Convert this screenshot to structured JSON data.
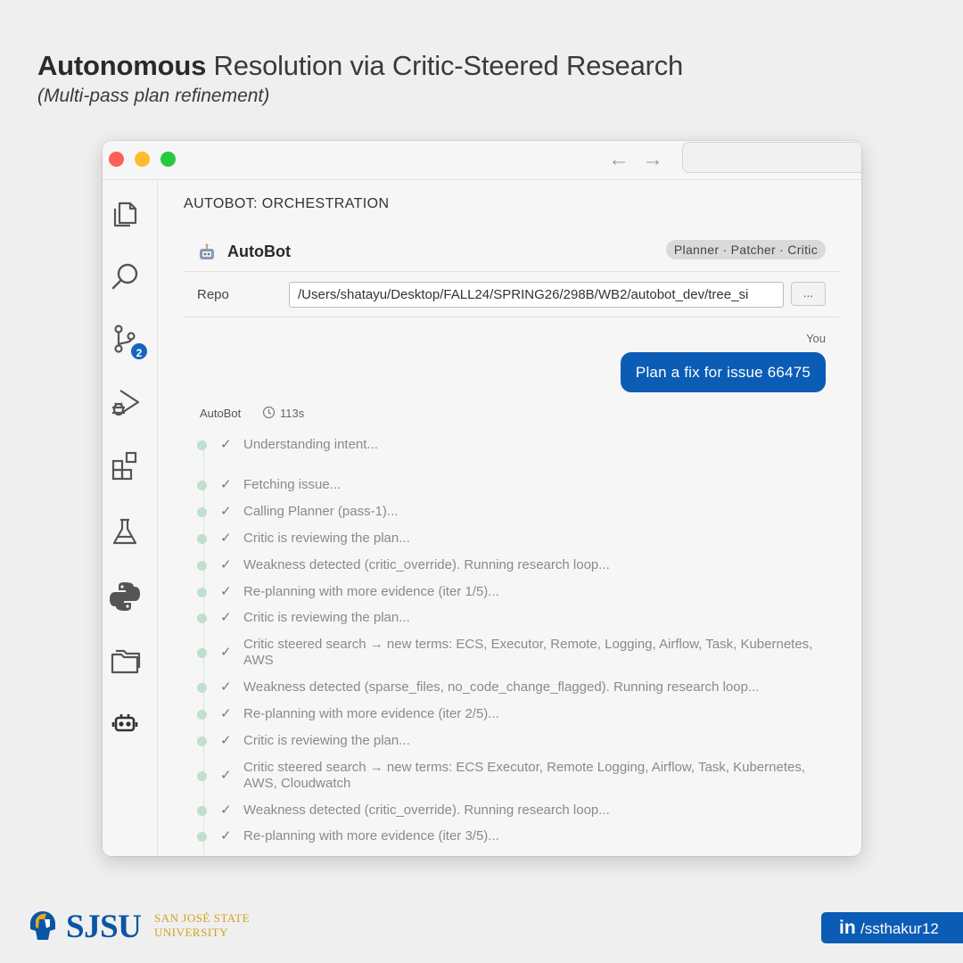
{
  "headline": {
    "bold": "Autonomous",
    "rest": " Resolution via Critic-Steered Research",
    "subtitle": "(Multi-pass plan refinement)"
  },
  "window": {
    "nav": {
      "back": "←",
      "forward": "→"
    },
    "activity_bar": {
      "source_control_badge": "2"
    },
    "panel": {
      "title": "AUTOBOT: ORCHESTRATION",
      "app_name": "AutoBot",
      "roles": "Planner · Patcher · Critic",
      "repo_label": "Repo",
      "repo_value": "/Users/shatayu/Desktop/FALL24/SPRING26/298B/WB2/autobot_dev/tree_si",
      "more_button": "...",
      "user_label": "You",
      "user_message": "Plan a fix for issue 66475",
      "bot_label": "AutoBot",
      "elapsed": "113s",
      "steps": [
        "Understanding intent...",
        "Fetching issue...",
        "Calling Planner (pass-1)...",
        "Critic is reviewing the plan...",
        "Weakness detected (critic_override). Running research loop...",
        "Re-planning with more evidence (iter 1/5)...",
        "Critic is reviewing the plan...",
        "Critic steered search → new terms: ECS, Executor, Remote, Logging, Airflow, Task, Kubernetes, AWS",
        "Weakness detected (sparse_files, no_code_change_flagged). Running research loop...",
        "Re-planning with more evidence (iter 2/5)...",
        "Critic is reviewing the plan...",
        "Critic steered search → new terms: ECS Executor, Remote Logging, Airflow, Task, Kubernetes, AWS, Cloudwatch",
        "Weakness detected (critic_override). Running research loop...",
        "Re-planning with more evidence (iter 3/5)..."
      ]
    }
  },
  "footer": {
    "logo_text": "SJSU",
    "university_line1": "SAN JOSÉ STATE",
    "university_line2": "UNIVERSITY",
    "social_icon": "in",
    "social_handle": "/ssthakur12"
  },
  "colors": {
    "accent": "#0b5cb5",
    "step_dot": "#bfe0cd",
    "background": "#efefef"
  }
}
